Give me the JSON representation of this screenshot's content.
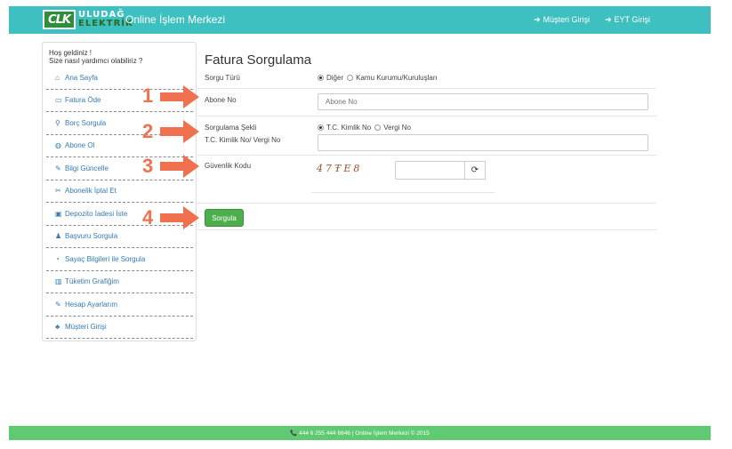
{
  "header": {
    "logo_mark": "CLK",
    "logo_line1": "ULUDAĞ",
    "logo_line2": "ELEKTRİK",
    "app_title": "Online İşlem Merkezi",
    "nav": [
      {
        "label": "Müşteri Girişi",
        "icon": "sign-in-icon"
      },
      {
        "label": "EYT Girişi",
        "icon": "sign-in-icon"
      }
    ]
  },
  "sidebar": {
    "welcome_line1": "Hoş geldiniz !",
    "welcome_line2": "Size nasıl yardımcı olabiliriz ?",
    "items": [
      {
        "label": "Ana Sayfa",
        "icon": "home-icon",
        "glyph": "⌂"
      },
      {
        "label": "Fatura Öde",
        "icon": "credit-card-icon",
        "glyph": "▭"
      },
      {
        "label": "Borç Sorgula",
        "icon": "search-icon",
        "glyph": "⚲"
      },
      {
        "label": "Abone Ol",
        "icon": "globe-icon",
        "glyph": "◍"
      },
      {
        "label": "Bilgi Güncelle",
        "icon": "edit-icon",
        "glyph": "✎"
      },
      {
        "label": "Abonelik İptal Et",
        "icon": "scissors-icon",
        "glyph": "✂"
      },
      {
        "label": "Depozito İadesi İste",
        "icon": "money-icon",
        "glyph": "▣"
      },
      {
        "label": "Başvuru Sorgula",
        "icon": "user-plus-icon",
        "glyph": "♟"
      },
      {
        "label": "Sayaç Bilgileri ile Sorgula",
        "icon": "clock-icon",
        "glyph": "◔"
      },
      {
        "label": "Tüketim Grafiğim",
        "icon": "bar-chart-icon",
        "glyph": "▥"
      },
      {
        "label": "Hesap Ayarlarım",
        "icon": "edit-icon",
        "glyph": "✎"
      },
      {
        "label": "Müşteri Girişi",
        "icon": "users-icon",
        "glyph": "♣"
      }
    ]
  },
  "form": {
    "title": "Fatura Sorgulama",
    "query_type_label": "Sorgu Türü",
    "query_type_options": [
      "Diğer",
      "Kamu Kurumu/Kuruluşları"
    ],
    "query_type_selected": "Diğer",
    "subscriber_label": "Abone No",
    "subscriber_placeholder": "Abone No",
    "method_label": "Sorgulama Şekli",
    "method_options": [
      "T.C. Kimlik No",
      "Vergi No"
    ],
    "method_selected": "T.C. Kimlik No",
    "id_label": "T.C. Kimlik No/ Vergi No",
    "id_value": "",
    "captcha_label": "Güvenlik Kodu",
    "captcha_text": "47ŦE8",
    "captcha_value": "",
    "submit_label": "Sorgula"
  },
  "annotations": [
    "1",
    "2",
    "3",
    "4"
  ],
  "footer": {
    "text": "📞 444 6 255 444 6646 | Online İşlem Merkezi © 2015"
  },
  "colors": {
    "header_bg": "#3fc0c0",
    "footer_bg": "#5fca72",
    "link": "#337ab7",
    "submit": "#4cae4c",
    "arrow": "#f0714f"
  }
}
